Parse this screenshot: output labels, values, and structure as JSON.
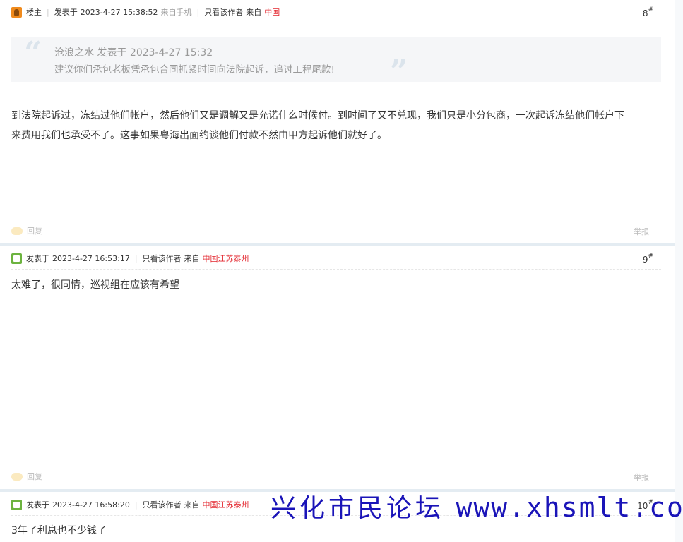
{
  "posts": [
    {
      "badge": "楼主",
      "posted_label": "发表于",
      "datetime": "2023-4-27 15:38:52",
      "source": "来自手机",
      "only_author": "只看该作者",
      "from_label": "来自",
      "location": "中国",
      "floor": "8",
      "floor_mark": "#",
      "quote": {
        "author": "沧浪之水",
        "posted_label": "发表于",
        "datetime": "2023-4-27 15:32",
        "text": "建议你们承包老板凭承包合同抓紧时间向法院起诉，追讨工程尾款!"
      },
      "content_line1": "到法院起诉过，冻结过他们帐户，然后他们又是调解又是允诺什么时候付。到时间了又不兑现，我们只是小分包商，一次起诉冻结他们帐户下",
      "content_line2": "来费用我们也承受不了。这事如果粤海出面约谈他们付款不然由甲方起诉他们就好了。",
      "reply_label": "回复",
      "report_label": "举报"
    },
    {
      "posted_label": "发表于",
      "datetime": "2023-4-27 16:53:17",
      "only_author": "只看该作者",
      "from_label": "来自",
      "location": "中国江苏泰州",
      "floor": "9",
      "floor_mark": "#",
      "content": "太难了，很同情，巡视组在应该有希望",
      "reply_label": "回复",
      "report_label": "举报"
    },
    {
      "posted_label": "发表于",
      "datetime": "2023-4-27 16:58:20",
      "only_author": "只看该作者",
      "from_label": "来自",
      "location": "中国江苏泰州",
      "floor": "10",
      "floor_mark": "#",
      "content": "3年了利息也不少钱了"
    }
  ],
  "watermark": {
    "name": "兴化市民论坛",
    "url": "www.xhsmlt.com"
  },
  "colors": {
    "location_red": "#e3262e",
    "watermark_blue": "#1a14b8",
    "separator": "#e4ecf2"
  },
  "icons": {
    "louzhu": "louzhu-badge-icon",
    "user": "user-icon",
    "reply": "reply-bubble-icon",
    "quote": "quote-marks-icon"
  }
}
